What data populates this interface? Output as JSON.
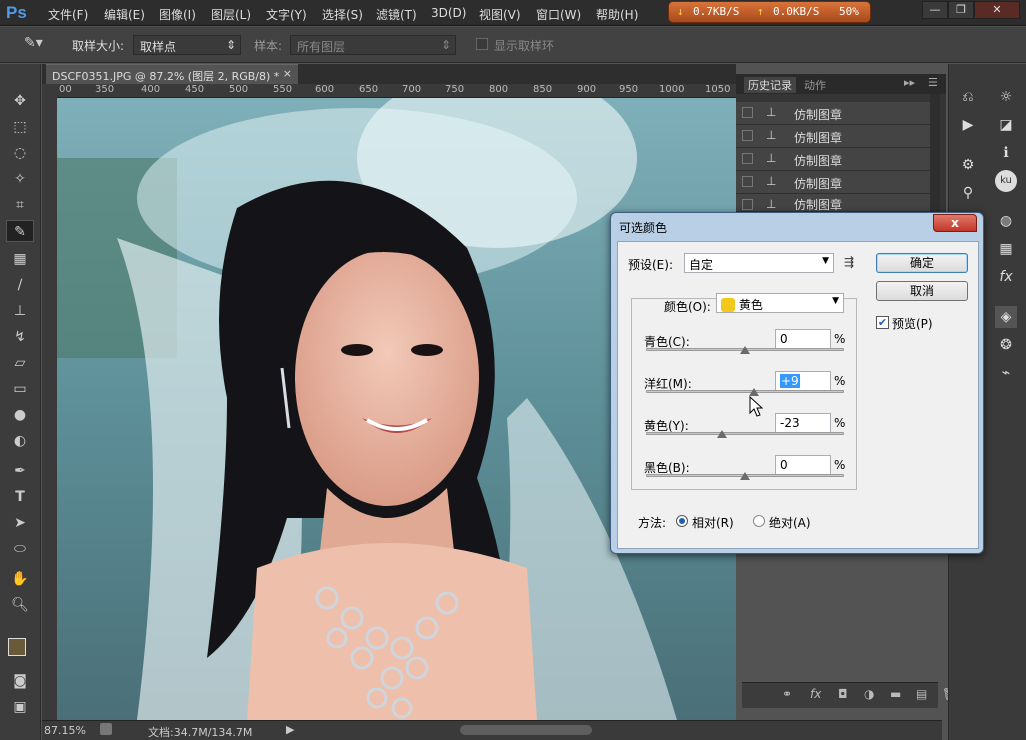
{
  "app": {
    "logo": "Ps"
  },
  "menu": [
    "文件(F)",
    "编辑(E)",
    "图像(I)",
    "图层(L)",
    "文字(Y)",
    "选择(S)",
    "滤镜(T)",
    "3D(D)",
    "视图(V)",
    "窗口(W)",
    "帮助(H)"
  ],
  "netmon": {
    "down": "0.7KB/S",
    "up": "0.0KB/S",
    "pct": "50%"
  },
  "options": {
    "sample_size_label": "取样大小:",
    "sample_size_value": "取样点",
    "sample_label": "样本:",
    "sample_value": "所有图层",
    "show_ring_label": "显示取样环"
  },
  "document": {
    "tab_title": "DSCF0351.JPG @ 87.2% (图层 2, RGB/8) *",
    "close": "×"
  },
  "ruler": [
    "00",
    "350",
    "400",
    "450",
    "500",
    "550",
    "600",
    "650",
    "700",
    "750",
    "800",
    "850",
    "900",
    "950",
    "1000",
    "1050"
  ],
  "status": {
    "zoom": "87.15%",
    "doc": "文档:34.7M/134.7M"
  },
  "history": {
    "tabs": [
      "历史记录",
      "动作"
    ],
    "items": [
      "仿制图章",
      "仿制图章",
      "仿制图章",
      "仿制图章",
      "仿制图章"
    ]
  },
  "dialog": {
    "title": "可选颜色",
    "close": "x",
    "preset_label": "预设(E):",
    "preset_value": "自定",
    "colors_label": "颜色(O):",
    "colors_value": "黄色",
    "colors_swatch": "#f2c81a",
    "ok": "确定",
    "cancel": "取消",
    "preview_label": "预览(P)",
    "sliders": [
      {
        "label": "青色(C):",
        "value": "0",
        "level": 0.5
      },
      {
        "label": "洋红(M):",
        "value": "+9",
        "level": 0.545
      },
      {
        "label": "黄色(Y):",
        "value": "-23",
        "level": 0.385
      },
      {
        "label": "黑色(B):",
        "value": "0",
        "level": 0.5
      }
    ],
    "pct": "%",
    "method_label": "方法:",
    "method_relative": "相对(R)",
    "method_absolute": "绝对(A)"
  }
}
